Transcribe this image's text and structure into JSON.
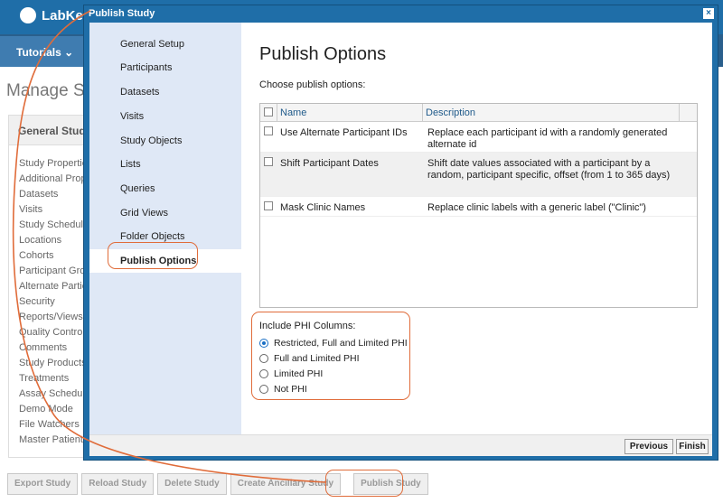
{
  "background": {
    "brand": "LabKey",
    "tutorials_label": "Tutorials",
    "page_title": "Manage Study",
    "panel_title": "General Study",
    "links": [
      "Study Properties",
      "Additional Properties",
      "Datasets",
      "Visits",
      "Study Schedule",
      "Locations",
      "Cohorts",
      "Participant Groups",
      "Alternate Participant IDs",
      "Security",
      "Reports/Views",
      "Quality Control",
      "Comments",
      "Study Products",
      "Treatments",
      "Assay Schedule",
      "Demo Mode",
      "File Watchers",
      "Master Patient Index"
    ],
    "buttons": [
      "Export Study",
      "Reload Study",
      "Delete Study",
      "Create Ancillary Study",
      "Publish Study"
    ]
  },
  "dialog": {
    "title": "Publish Study",
    "close_glyph": "×",
    "steps": [
      "General Setup",
      "Participants",
      "Datasets",
      "Visits",
      "Study Objects",
      "Lists",
      "Queries",
      "Grid Views",
      "Folder Objects",
      "Publish Options"
    ],
    "active_step": "Publish Options",
    "heading": "Publish Options",
    "subheading": "Choose publish options:",
    "grid": {
      "columns": [
        "Name",
        "Description"
      ],
      "rows": [
        {
          "name": "Use Alternate Participant IDs",
          "description": "Replace each participant id with a randomly generated alternate id"
        },
        {
          "name": "Shift Participant Dates",
          "description": "Shift date values associated with a participant by a random, participant specific, offset (from 1 to 365 days)"
        },
        {
          "name": "Mask Clinic Names",
          "description": "Replace clinic labels with a generic label (\"Clinic\")"
        }
      ]
    },
    "phi": {
      "label": "Include PHI Columns:",
      "options": [
        "Restricted, Full and Limited PHI",
        "Full and Limited PHI",
        "Limited PHI",
        "Not PHI"
      ],
      "selected": "Restricted, Full and Limited PHI"
    },
    "buttons": {
      "previous": "Previous",
      "finish": "Finish"
    }
  },
  "colors": {
    "header_blue": "#1f6ea8",
    "nav_blue": "#2a5f8c",
    "highlight_orange": "#e06c3a",
    "sidebar_bg": "#dfe8f6"
  }
}
